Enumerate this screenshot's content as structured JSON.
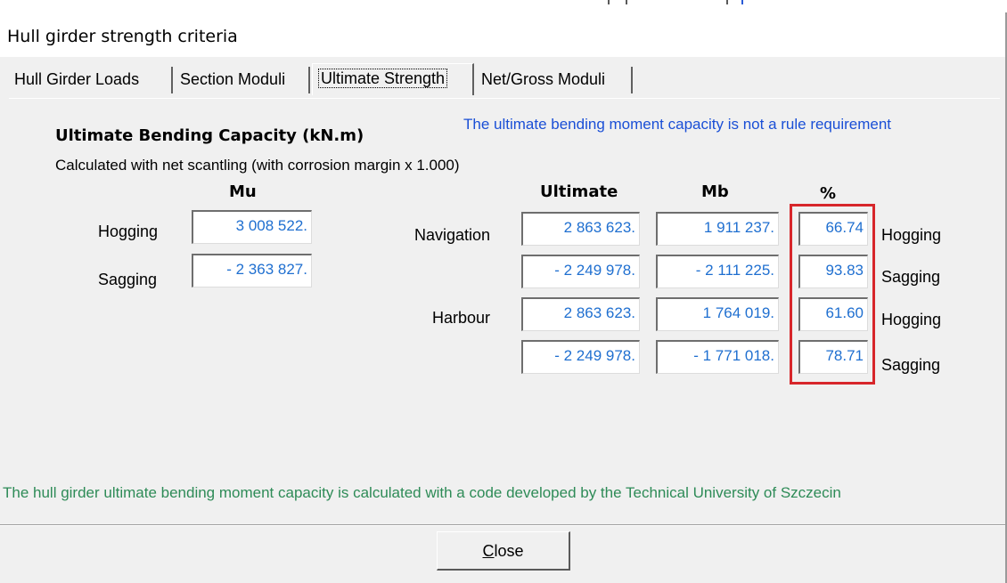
{
  "window": {
    "title": "Hull girder strength criteria"
  },
  "tabs": [
    {
      "label": "Hull Girder Loads"
    },
    {
      "label": "Section Moduli"
    },
    {
      "label": "Ultimate Strength"
    },
    {
      "label": "Net/Gross Moduli"
    }
  ],
  "active_tab": "Ultimate Strength",
  "content": {
    "heading": "Ultimate Bending Capacity (kN.m)",
    "note": "The ultimate bending moment capacity is not a rule requirement",
    "subtitle": "Calculated with net scantling (with corrosion margin x 1.000)",
    "col_mu": "Mu",
    "col_ultimate": "Ultimate",
    "col_mb": "Mb",
    "col_pct": "%",
    "mu_rows": [
      {
        "label": "Hogging",
        "value": "3 008 522."
      },
      {
        "label": "Sagging",
        "value": "- 2 363 827."
      }
    ],
    "groups": [
      {
        "label": "Navigation"
      },
      {
        "label": "Harbour"
      }
    ],
    "rows": [
      {
        "ultimate": "2 863 623.",
        "mb": "1 911 237.",
        "pct": "66.74",
        "state": "Hogging"
      },
      {
        "ultimate": "- 2 249 978.",
        "mb": "- 2 111 225.",
        "pct": "93.83",
        "state": "Sagging"
      },
      {
        "ultimate": "2 863 623.",
        "mb": "1 764 019.",
        "pct": "61.60",
        "state": "Hogging"
      },
      {
        "ultimate": "- 2 249 978.",
        "mb": "- 1 771 018.",
        "pct": "78.71",
        "state": "Sagging"
      }
    ],
    "credit": "The hull girder ultimate bending moment capacity is calculated with a code developed by the Technical University of Szczecin"
  },
  "buttons": {
    "close_first": "C",
    "close_rest": "lose"
  },
  "colors": {
    "value_text": "#1f6fd0",
    "note_text": "#1a4fd6",
    "credit_text": "#2e8b57",
    "highlight": "#d7262b"
  }
}
